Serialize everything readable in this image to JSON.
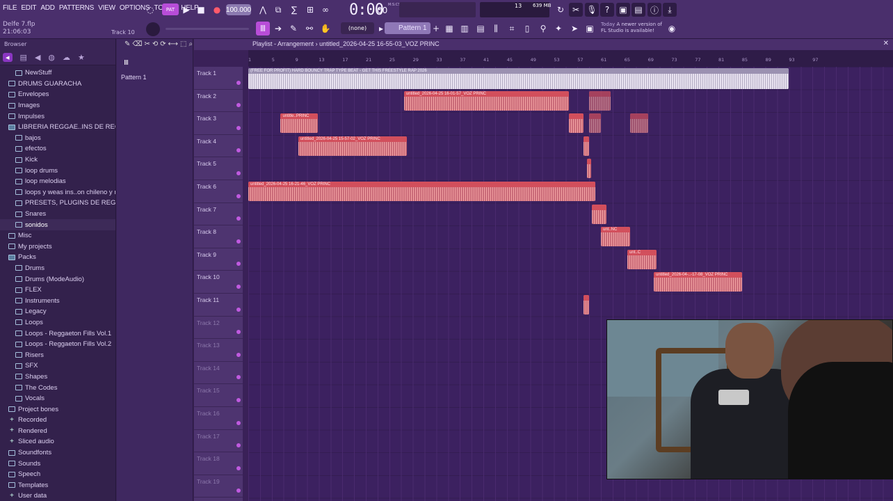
{
  "menu": [
    "FILE",
    "EDIT",
    "ADD",
    "PATTERNS",
    "VIEW",
    "OPTIONS",
    "TOOLS",
    "HELP"
  ],
  "project": {
    "name": "Delfe 7.flp",
    "time": "21:06:03",
    "hint": "Track 10"
  },
  "transport": {
    "pattern_mode": "PAT",
    "bpm": "100.000",
    "time": "0:00",
    "time_sub": "00",
    "time_label": "M:S:CS",
    "cpu": "13",
    "memory": "639 MB"
  },
  "tools": {
    "snap": "(none)",
    "pattern": "Pattern 1"
  },
  "update": {
    "today": "Today",
    "msg": "A newer version of FL Studio is available!"
  },
  "browser": {
    "title": "Browser",
    "items": [
      {
        "label": "NewStuff",
        "level": 1,
        "kind": "file"
      },
      {
        "label": "DRUMS GUARACHA",
        "level": 0
      },
      {
        "label": "Envelopes",
        "level": 0
      },
      {
        "label": "Images",
        "level": 0
      },
      {
        "label": "Impulses",
        "level": 0
      },
      {
        "label": "LIBRERIA REGGAE..INS DE REGALO",
        "level": 0,
        "open": true
      },
      {
        "label": "bajos",
        "level": 1
      },
      {
        "label": "efectos",
        "level": 1
      },
      {
        "label": "Kick",
        "level": 1
      },
      {
        "label": "loop drums",
        "level": 1
      },
      {
        "label": "loop melodias",
        "level": 1
      },
      {
        "label": "loops y weas ins..on chileno y mas",
        "level": 1
      },
      {
        "label": "PRESETS, PLUGINS DE REGALO",
        "level": 1
      },
      {
        "label": "Snares",
        "level": 1
      },
      {
        "label": "sonidos",
        "level": 1,
        "active": true
      },
      {
        "label": "Misc",
        "level": 0
      },
      {
        "label": "My projects",
        "level": 0
      },
      {
        "label": "Packs",
        "level": 0,
        "open": true
      },
      {
        "label": "Drums",
        "level": 1
      },
      {
        "label": "Drums (ModeAudio)",
        "level": 1
      },
      {
        "label": "FLEX",
        "level": 1
      },
      {
        "label": "Instruments",
        "level": 1
      },
      {
        "label": "Legacy",
        "level": 1
      },
      {
        "label": "Loops",
        "level": 1
      },
      {
        "label": "Loops - Reggaeton Fills Vol.1",
        "level": 1
      },
      {
        "label": "Loops - Reggaeton Fills Vol.2",
        "level": 1
      },
      {
        "label": "Risers",
        "level": 1
      },
      {
        "label": "SFX",
        "level": 1
      },
      {
        "label": "Shapes",
        "level": 1
      },
      {
        "label": "The Codes",
        "level": 1
      },
      {
        "label": "Vocals",
        "level": 1
      },
      {
        "label": "Project bones",
        "level": 0
      },
      {
        "label": "Recorded",
        "level": 0,
        "plus": true
      },
      {
        "label": "Rendered",
        "level": 0,
        "plus": true
      },
      {
        "label": "Sliced audio",
        "level": 0,
        "plus": true
      },
      {
        "label": "Soundfonts",
        "level": 0
      },
      {
        "label": "Sounds",
        "level": 0
      },
      {
        "label": "Speech",
        "level": 0
      },
      {
        "label": "Templates",
        "level": 0
      },
      {
        "label": "User data",
        "level": 0,
        "plus": true
      }
    ]
  },
  "patterns": {
    "item": "Pattern 1"
  },
  "playlist": {
    "title": "Playlist - Arrangement",
    "project": "untitled_2026-04-25 16-55-03_VOZ PRINC",
    "ruler": [
      "1",
      "5",
      "9",
      "13",
      "17",
      "21",
      "25",
      "29",
      "33",
      "37",
      "41",
      "45",
      "49",
      "53",
      "57",
      "61",
      "65",
      "69",
      "73",
      "77",
      "81",
      "85",
      "89",
      "93",
      "97"
    ],
    "tracks": [
      "Track 1",
      "Track 2",
      "Track 3",
      "Track 4",
      "Track 5",
      "Track 6",
      "Track 7",
      "Track 8",
      "Track 9",
      "Track 10",
      "Track 11",
      "Track 12",
      "Track 13",
      "Track 14",
      "Track 15",
      "Track 16",
      "Track 17",
      "Track 18",
      "Track 19"
    ],
    "clips": [
      {
        "label": "(FREE FOR PROFIT) HARD BOUNCY TRAP TYPE BEAT - GET THIS  FREESTYLE RAP 2026",
        "track": 0,
        "start": 1,
        "end": 93,
        "style": "grey"
      },
      {
        "label": "untitled_2026-04-25 16-01-57_VOZ PRINC",
        "track": 1,
        "start": 27.5,
        "end": 55.5,
        "style": "red"
      },
      {
        "label": "",
        "track": 1,
        "start": 59,
        "end": 62.6,
        "style": "ghost"
      },
      {
        "label": "untitle..PRINC",
        "track": 2,
        "start": 6.5,
        "end": 12.8,
        "style": "red"
      },
      {
        "label": "",
        "track": 2,
        "start": 55.5,
        "end": 58,
        "style": "red"
      },
      {
        "label": "",
        "track": 2,
        "start": 59,
        "end": 61,
        "style": "ghost"
      },
      {
        "label": "",
        "track": 2,
        "start": 66,
        "end": 69,
        "style": "ghost"
      },
      {
        "label": "untitled_2026-04-25 15-57-02_VOZ PRINC",
        "track": 3,
        "start": 9.5,
        "end": 28,
        "style": "red"
      },
      {
        "label": "",
        "track": 3,
        "start": 58,
        "end": 59,
        "style": "red"
      },
      {
        "label": "",
        "track": 4,
        "start": 58.6,
        "end": 59.4,
        "style": "red"
      },
      {
        "label": "untitled_2026-04-25 16-21-46_VOZ PRINC",
        "track": 5,
        "start": 1,
        "end": 60,
        "style": "red"
      },
      {
        "label": "",
        "track": 6,
        "start": 59.5,
        "end": 62,
        "style": "red"
      },
      {
        "label": "unt..NC",
        "track": 7,
        "start": 61,
        "end": 66,
        "style": "red"
      },
      {
        "label": "unt..C",
        "track": 8,
        "start": 65.5,
        "end": 70.5,
        "style": "red"
      },
      {
        "label": "untitled_2026-04-..-17-08_VOZ PRINC",
        "track": 9,
        "start": 70,
        "end": 85,
        "style": "red"
      },
      {
        "label": "",
        "track": 10,
        "start": 58,
        "end": 59,
        "style": "red"
      }
    ]
  }
}
